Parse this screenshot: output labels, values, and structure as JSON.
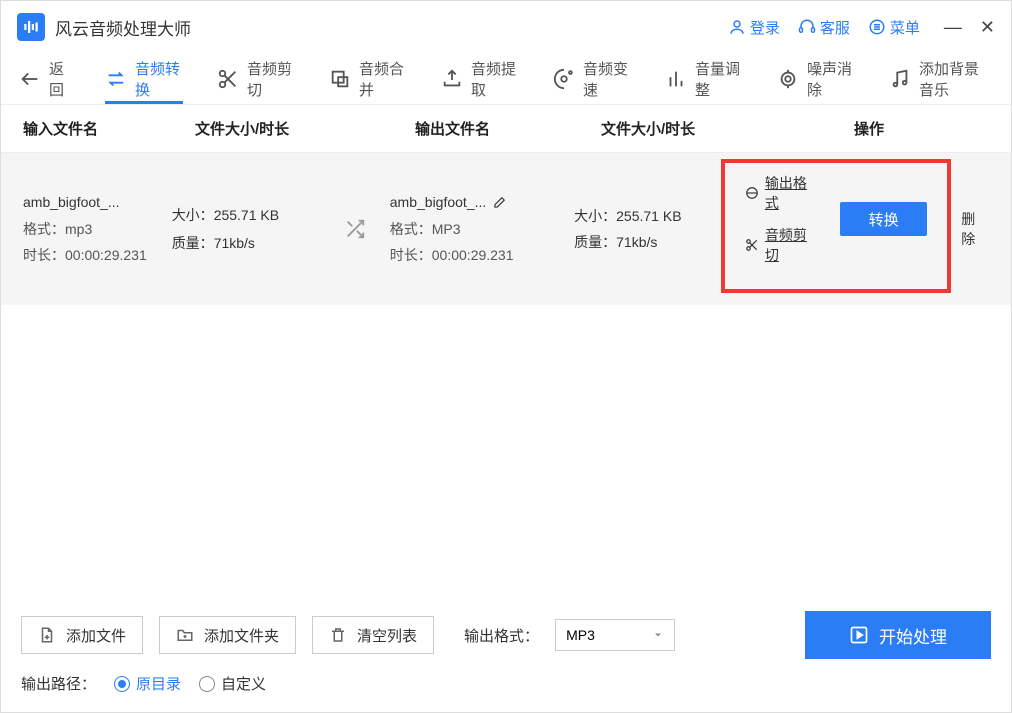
{
  "app": {
    "title": "风云音频处理大师"
  },
  "titlebar": {
    "login": "登录",
    "support": "客服",
    "menu": "菜单"
  },
  "tabs": {
    "back": "返回",
    "convert": "音频转换",
    "cut": "音频剪切",
    "merge": "音频合并",
    "extract": "音频提取",
    "speed": "音频变速",
    "volume": "音量调整",
    "denoise": "噪声消除",
    "bgm": "添加背景音乐"
  },
  "headers": {
    "input_name": "输入文件名",
    "size_dur1": "文件大小/时长",
    "output_name": "输出文件名",
    "size_dur2": "文件大小/时长",
    "operation": "操作"
  },
  "row": {
    "in_name": "amb_bigfoot_...",
    "in_fmt": "格式：mp3",
    "in_dur": "时长：00:00:29.231",
    "size1_label": "大小：",
    "size1_val": "255.71 KB",
    "qual1_label": "质量：",
    "qual1_val": "71kb/s",
    "out_name": "amb_bigfoot_...",
    "out_fmt": "格式：MP3",
    "out_dur": "时长：00:00:29.231",
    "size2_label": "大小：",
    "size2_val": "255.71 KB",
    "qual2_label": "质量：",
    "qual2_val": "71kb/s",
    "op_format": "输出格式",
    "op_cut": "音频剪切",
    "convert": "转换",
    "delete": "删除"
  },
  "footer": {
    "add_file": "添加文件",
    "add_folder": "添加文件夹",
    "clear": "清空列表",
    "fmt_label": "输出格式：",
    "fmt_value": "MP3",
    "start": "开始处理",
    "path_label": "输出路径：",
    "path_orig": "原目录",
    "path_custom": "自定义"
  }
}
